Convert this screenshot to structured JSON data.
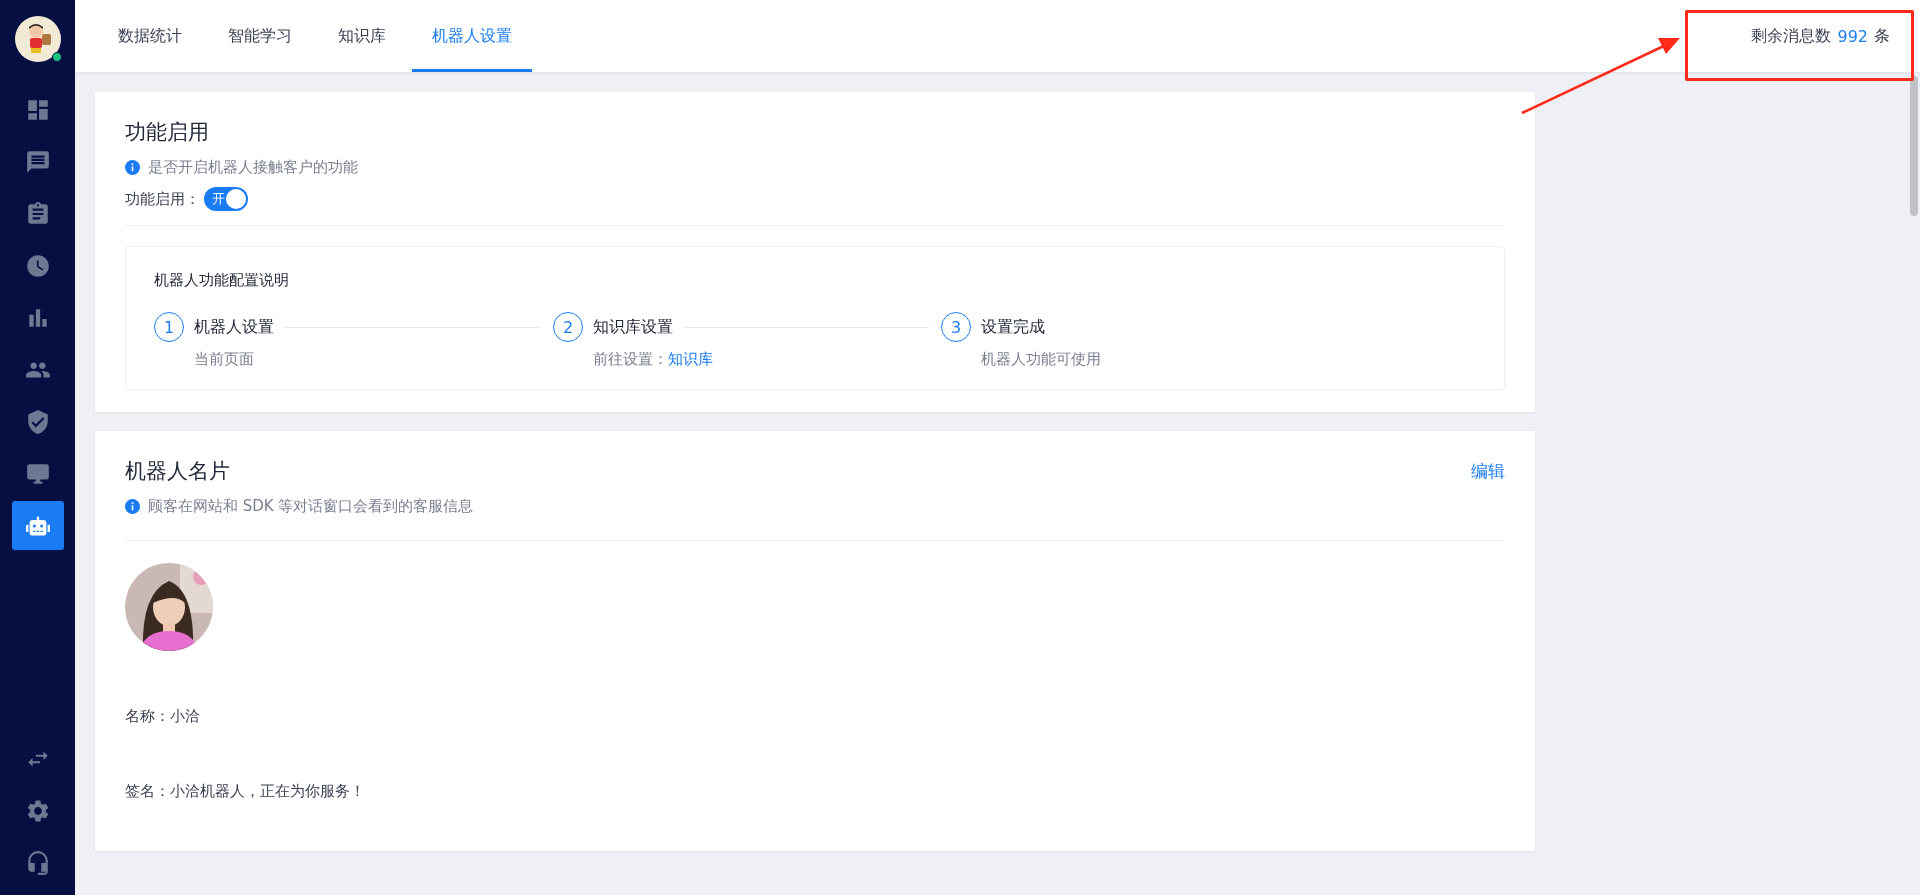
{
  "sidebar": {
    "user_avatar": {
      "online": true
    },
    "items": [
      {
        "kind": "dashboard",
        "selected": false
      },
      {
        "kind": "messages",
        "selected": false
      },
      {
        "kind": "clipboard",
        "selected": false
      },
      {
        "kind": "clock",
        "selected": false
      },
      {
        "kind": "chart",
        "selected": false
      },
      {
        "kind": "users",
        "selected": false
      },
      {
        "kind": "shield",
        "selected": false
      },
      {
        "kind": "monitor",
        "selected": false
      },
      {
        "kind": "robot",
        "selected": true
      }
    ],
    "bottom_items": [
      {
        "kind": "switch",
        "selected": false
      },
      {
        "kind": "settings",
        "selected": false
      },
      {
        "kind": "headset",
        "selected": false
      }
    ]
  },
  "tabs": [
    {
      "label": "数据统计",
      "selected": false
    },
    {
      "label": "智能学习",
      "selected": false
    },
    {
      "label": "知识库",
      "selected": false
    },
    {
      "label": "机器人设置",
      "selected": true
    }
  ],
  "message_quota": {
    "label": "剩余消息数",
    "count": "992",
    "unit": "条"
  },
  "enable_card": {
    "title": "功能启用",
    "hint": "是否开启机器人接触客户的功能",
    "toggle": {
      "label": "功能启用：",
      "on": true,
      "text": "开"
    },
    "guide": {
      "title": "机器人功能配置说明",
      "steps": [
        {
          "number": "1",
          "title": "机器人设置",
          "desc": "当前页面"
        },
        {
          "number": "2",
          "title": "知识库设置",
          "desc": "前往设置：",
          "link": "知识库"
        },
        {
          "number": "3",
          "title": "设置完成",
          "desc": "机器人功能可使用"
        }
      ]
    }
  },
  "profile_card": {
    "title": "机器人名片",
    "action": "编辑",
    "hint": "顾客在网站和 SDK 等对话窗口会看到的客服信息",
    "avatar": {
      "kind": "picture"
    },
    "fields": [
      "名称：小洽",
      "签名：小洽机器人，正在为你服务！"
    ]
  }
}
